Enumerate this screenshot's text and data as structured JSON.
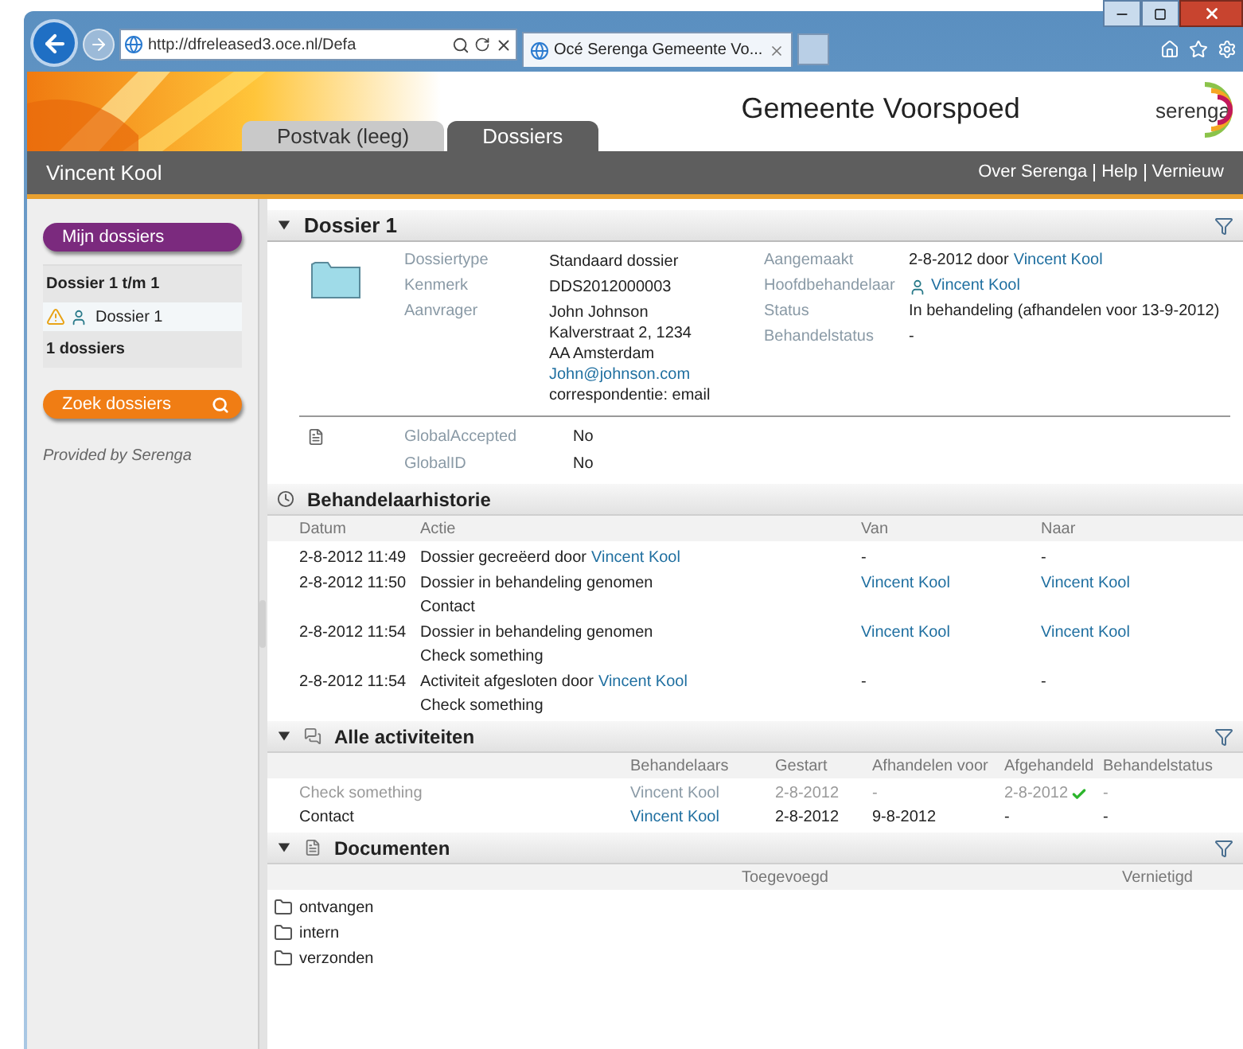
{
  "browser": {
    "address": "http://dfreleased3.oce.nl/Defa",
    "tab": "Océ Serenga Gemeente Vo..."
  },
  "header": {
    "tabs": [
      {
        "label": "Postvak (leeg)",
        "selected": false
      },
      {
        "label": "Dossiers",
        "selected": true
      }
    ],
    "title": "Gemeente Voorspoed",
    "logo": "serenga"
  },
  "userbar": {
    "user": "Vincent Kool",
    "links": [
      "Over Serenga",
      "Help",
      "Vernieuw"
    ]
  },
  "sidebar": {
    "mine_button": "Mijn dossiers",
    "range": "Dossier 1 t/m 1",
    "items": [
      {
        "label": "Dossier 1",
        "selected": true,
        "warning": true
      }
    ],
    "count": "1 dossiers",
    "search_button": "Zoek dossiers",
    "footer": "Provided by Serenga"
  },
  "dossier": {
    "title": "Dossier 1",
    "expanded": true,
    "left": [
      {
        "label": "Dossiertype",
        "lines": [
          {
            "kind": "text",
            "text": "Standaard dossier"
          }
        ]
      },
      {
        "label": "Kenmerk",
        "lines": [
          {
            "kind": "text",
            "text": "DDS2012000003"
          }
        ]
      },
      {
        "label": "Aanvrager",
        "lines": [
          {
            "kind": "text",
            "text": "John Johnson"
          },
          {
            "kind": "text",
            "text": "Kalverstraat 2, 1234"
          },
          {
            "kind": "text",
            "text": "AA Amsterdam"
          },
          {
            "kind": "link",
            "text": "John@johnson.com"
          },
          {
            "kind": "text",
            "text": "correspondentie: email"
          }
        ]
      }
    ],
    "right": [
      {
        "label": "Aangemaakt",
        "text": "2-8-2012 door",
        "link": "Vincent Kool"
      },
      {
        "label": "Hoofdbehandelaar",
        "link": "Vincent Kool",
        "person": true
      },
      {
        "label": "Status",
        "text": "In behandeling (afhandelen voor 13-9-2012)"
      },
      {
        "label": "Behandelstatus",
        "text": "-"
      }
    ],
    "extra": [
      {
        "label": "GlobalAccepted",
        "value": "No"
      },
      {
        "label": "GlobalID",
        "value": "No"
      }
    ]
  },
  "history": {
    "title": "Behandelaarhistorie",
    "columns": [
      "Datum",
      "Actie",
      "Van",
      "Naar"
    ],
    "rows": [
      {
        "date": "2-8-2012 11:49",
        "action": "Dossier gecreëerd door",
        "action_link": "Vincent Kool",
        "van": "-",
        "van_link": false,
        "naar": "-",
        "naar_link": false
      },
      {
        "date": "2-8-2012 11:50",
        "action": "Dossier in behandeling genomen",
        "sub": "Contact",
        "van": "Vincent Kool",
        "van_link": true,
        "naar": "Vincent Kool",
        "naar_link": true
      },
      {
        "date": "2-8-2012 11:54",
        "action": "Dossier in behandeling genomen",
        "sub": "Check something",
        "van": "Vincent Kool",
        "van_link": true,
        "naar": "Vincent Kool",
        "naar_link": true
      },
      {
        "date": "2-8-2012 11:54",
        "action": "Activiteit afgesloten door",
        "action_link": "Vincent Kool",
        "sub": "Check something",
        "van": "-",
        "van_link": false,
        "naar": "-",
        "naar_link": false
      }
    ]
  },
  "activities": {
    "title": "Alle activiteiten",
    "expanded": true,
    "columns": [
      "Behandelaars",
      "Gestart",
      "Afhandelen voor",
      "Afgehandeld",
      "Behandelstatus"
    ],
    "rows": [
      {
        "name": "Check something",
        "handler": "Vincent Kool",
        "started": "2-8-2012",
        "due": "-",
        "done_date": "2-8-2012",
        "status": "-",
        "done": true
      },
      {
        "name": "Contact",
        "handler": "Vincent Kool",
        "started": "2-8-2012",
        "due": "9-8-2012",
        "done_date": "-",
        "status": "-",
        "done": false
      }
    ]
  },
  "documents": {
    "title": "Documenten",
    "expanded": true,
    "columns": [
      "Toegevoegd",
      "Vernietigd"
    ],
    "folders": [
      "ontvangen",
      "intern",
      "verzonden"
    ]
  }
}
